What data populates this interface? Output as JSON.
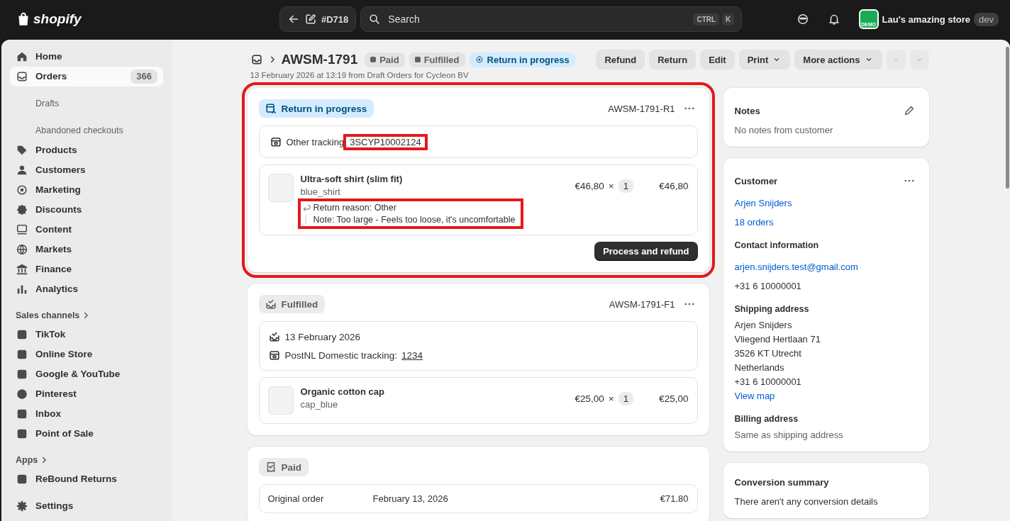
{
  "topbar": {
    "logo": "shopify",
    "back_label": "#D718",
    "search": {
      "placeholder": "Search",
      "keys": [
        "CTRL",
        "K"
      ]
    },
    "store": {
      "logo_text": "DEMO",
      "name": "Lau's amazing store",
      "badge": "dev"
    }
  },
  "sidebar": {
    "items": [
      {
        "label": "Home",
        "selected": false
      },
      {
        "label": "Orders",
        "selected": true,
        "count": "366",
        "children": [
          {
            "label": "Drafts",
            "selected": false
          },
          {
            "label": "Abandoned checkouts",
            "selected": false
          }
        ]
      },
      {
        "label": "Products",
        "selected": false
      },
      {
        "label": "Customers",
        "selected": false
      },
      {
        "label": "Marketing",
        "selected": false
      },
      {
        "label": "Discounts",
        "selected": false
      },
      {
        "label": "Content",
        "selected": false
      },
      {
        "label": "Markets",
        "selected": false
      },
      {
        "label": "Finance",
        "selected": false
      },
      {
        "label": "Analytics",
        "selected": false
      }
    ],
    "sections": [
      {
        "title": "Sales channels",
        "items": [
          {
            "label": "TikTok",
            "selected": false
          },
          {
            "label": "Online Store",
            "selected": false
          },
          {
            "label": "Google & YouTube",
            "selected": false
          },
          {
            "label": "Pinterest",
            "selected": false
          },
          {
            "label": "Inbox",
            "selected": false
          },
          {
            "label": "Point of Sale",
            "selected": false
          }
        ]
      },
      {
        "title": "Apps",
        "items": [
          {
            "label": "ReBound Returns",
            "selected": false
          }
        ]
      }
    ],
    "settings": {
      "label": "Settings",
      "selected": false
    }
  },
  "order": {
    "title": "AWSM-1791",
    "badges": [
      {
        "label": "Paid",
        "kind": "neutral"
      },
      {
        "label": "Fulfilled",
        "kind": "neutral"
      },
      {
        "label": "Return in progress",
        "kind": "info"
      }
    ],
    "subtitle": "13 February 2026 at 13:19 from Draft Orders for Cycleon BV",
    "actions": [
      {
        "label": "Refund",
        "dropdown": false
      },
      {
        "label": "Return",
        "dropdown": false
      },
      {
        "label": "Edit",
        "dropdown": false
      },
      {
        "label": "Print",
        "dropdown": true
      },
      {
        "label": "More actions",
        "dropdown": true
      }
    ],
    "nav": [
      {
        "kind": "previous",
        "disabled": true
      },
      {
        "kind": "next",
        "disabled": true
      }
    ]
  },
  "return_card": {
    "status": "Return in progress",
    "id": "AWSM-1791-R1",
    "highlighted": true,
    "tracking": {
      "label": "Other tracking",
      "number": "3SCYP10002124",
      "highlighted": true
    },
    "items": [
      {
        "name": "Ultra-soft shirt (slim fit)",
        "sku": "blue_shirt",
        "price": "€46,80",
        "times": "×",
        "quantity": "1",
        "total": "€46,80",
        "reason": {
          "text": "Return reason: Other",
          "note": "Note: Too large - Feels too loose, it's uncomfortable",
          "highlighted": true
        }
      }
    ],
    "action": "Process and refund"
  },
  "fulfilled_card": {
    "status": "Fulfilled",
    "id": "AWSM-1791-F1",
    "date": "13 February 2026",
    "tracking_label": "PostNL Domestic tracking:",
    "tracking_number": "1234",
    "items": [
      {
        "name": "Organic cotton cap",
        "sku": "cap_blue",
        "price": "€25,00",
        "times": "×",
        "quantity": "1",
        "total": "€25,00"
      }
    ]
  },
  "paid_card": {
    "status": "Paid",
    "rows": [
      {
        "label": "Original order",
        "date": "February 13, 2026",
        "amount": "€71.80"
      }
    ]
  },
  "notes": {
    "title": "Notes",
    "text": "No notes from customer"
  },
  "customer": {
    "title": "Customer",
    "name": "Arjen Snijders",
    "orders": "18 orders",
    "contact_title": "Contact information",
    "email": "arjen.snijders.test@gmail.com",
    "phone": "+31 6 10000001",
    "shipping_title": "Shipping address",
    "address": [
      "Arjen Snijders",
      "Vliegend Hertlaan 71",
      "3526 KT Utrecht",
      "Netherlands",
      "+31 6 10000001"
    ],
    "view_map": "View map",
    "billing_title": "Billing address",
    "billing_text": "Same as shipping address"
  },
  "conversion": {
    "title": "Conversion summary",
    "text": "There aren't any conversion details"
  }
}
